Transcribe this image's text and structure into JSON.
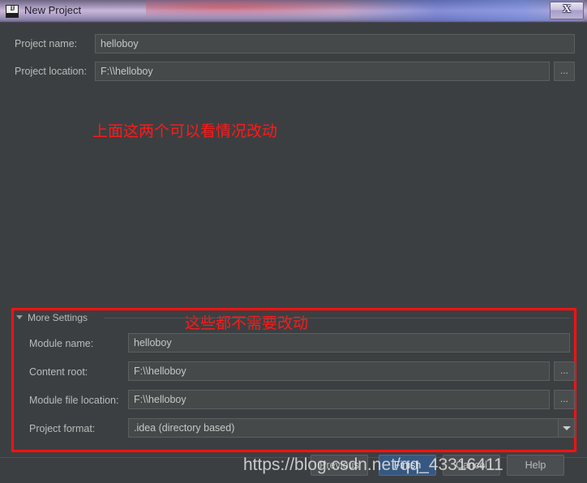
{
  "window": {
    "title": "New Project",
    "app_icon": "intellij-idea-icon",
    "close_label": "X"
  },
  "form": {
    "project_name_label": "Project name:",
    "project_name_value": "helloboy",
    "project_location_label": "Project location:",
    "project_location_value": "F:\\\\helloboy",
    "browse_label": "..."
  },
  "annotations": {
    "top_note": "上面这两个可以看情况改动",
    "bottom_note": "这些都不需要改动",
    "color": "#ff1111"
  },
  "more_settings": {
    "group_label": "More Settings",
    "rows": [
      {
        "label": "Module name:",
        "value": "helloboy",
        "browse": false
      },
      {
        "label": "Content root:",
        "value": "F:\\\\helloboy",
        "browse": true
      },
      {
        "label": "Module file location:",
        "value": "F:\\\\helloboy",
        "browse": true
      }
    ],
    "project_format_label": "Project format:",
    "project_format_value": ".idea (directory based)",
    "browse_label": "..."
  },
  "footer": {
    "previous_label": "Previous",
    "finish_label": "Finish",
    "cancel_label": "Cancel",
    "help_label": "Help",
    "accent_color": "#365880"
  },
  "watermark": {
    "text": "https://blog.csdn.net/qq_43316411"
  }
}
